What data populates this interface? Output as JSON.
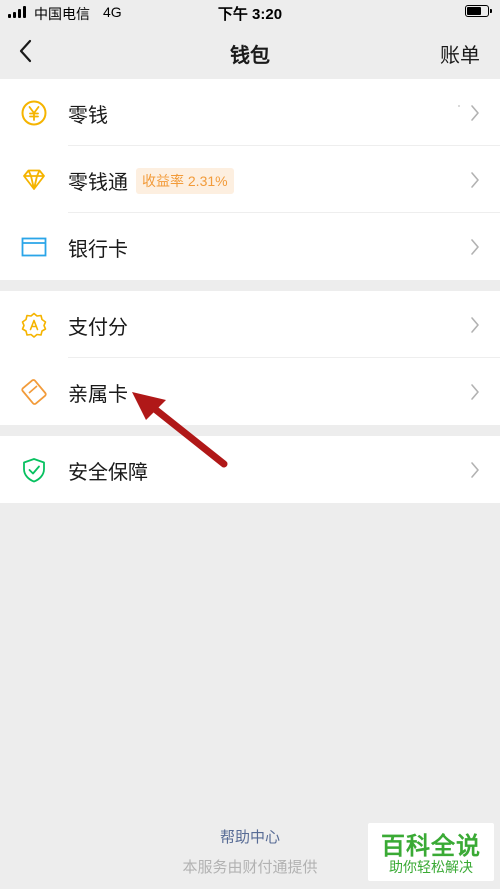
{
  "status_bar": {
    "carrier": "中国电信",
    "network": "4G",
    "time": "下午 3:20",
    "battery_level": 0.75
  },
  "nav": {
    "title": "钱包",
    "right_label": "账单",
    "back_icon": "chevron-left-icon"
  },
  "groups": [
    {
      "items": [
        {
          "label": "零钱",
          "icon": "yuan-coin-icon",
          "icon_color": "#f5b400"
        },
        {
          "label": "零钱通",
          "icon": "diamond-icon",
          "icon_color": "#f5b400",
          "badge": "收益率 2.31%"
        },
        {
          "label": "银行卡",
          "icon": "bank-card-icon",
          "icon_color": "#2aa5e8"
        }
      ]
    },
    {
      "items": [
        {
          "label": "支付分",
          "icon": "score-badge-icon",
          "icon_color": "#f5b400"
        },
        {
          "label": "亲属卡",
          "icon": "family-card-icon",
          "icon_color": "#f29b3a"
        }
      ]
    },
    {
      "items": [
        {
          "label": "安全保障",
          "icon": "shield-check-icon",
          "icon_color": "#07c160"
        }
      ]
    }
  ],
  "footer": {
    "help": "帮助中心",
    "provider": "本服务由财付通提供"
  },
  "watermark": {
    "main": "百科全说",
    "sub": "助你轻松解决"
  },
  "colors": {
    "background": "#ededed",
    "link": "#576b95",
    "badge_text": "#f29b3a",
    "badge_bg": "#fdefe0",
    "annotation_arrow": "#b01818"
  }
}
